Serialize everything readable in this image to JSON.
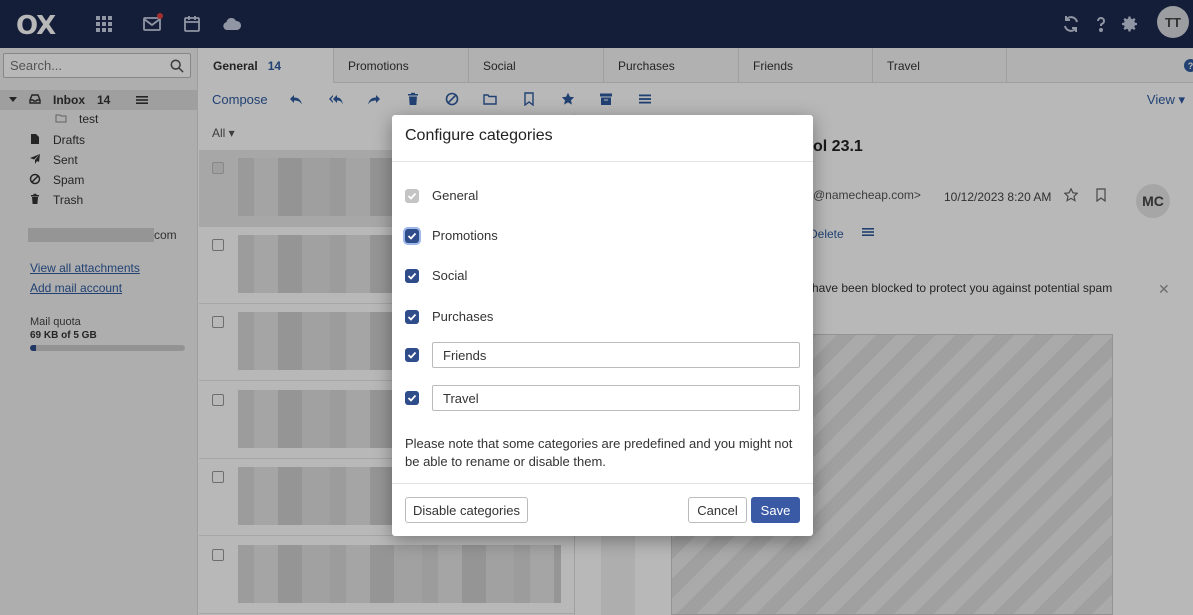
{
  "app": {
    "logo_text": "OX",
    "user_initials": "TT"
  },
  "sidebar": {
    "search_placeholder": "Search...",
    "inbox": {
      "label": "Inbox",
      "count": "14"
    },
    "folders": [
      {
        "label": "test",
        "icon": "folder-icon"
      },
      {
        "label": "Drafts",
        "icon": "file-icon"
      },
      {
        "label": "Sent",
        "icon": "send-icon"
      },
      {
        "label": "Spam",
        "icon": "ban-icon"
      },
      {
        "label": "Trash",
        "icon": "trash-icon"
      }
    ],
    "account_suffix": "com",
    "links": [
      "View all attachments",
      "Add mail account"
    ],
    "quota": {
      "label": "Mail quota",
      "value": "69 KB of 5 GB",
      "fill_percent": 4
    }
  },
  "tabs": [
    {
      "label": "General",
      "count": "14",
      "active": true
    },
    {
      "label": "Promotions"
    },
    {
      "label": "Social"
    },
    {
      "label": "Purchases"
    },
    {
      "label": "Friends"
    },
    {
      "label": "Travel"
    }
  ],
  "toolbar": {
    "compose": "Compose",
    "view": "View"
  },
  "list": {
    "filter": "All"
  },
  "message": {
    "subject_tail": "ol 23.1",
    "from_tail": "@namecheap.com>",
    "date": "10/12/2023 8:20 AM",
    "avatar": "MC",
    "delete_tail": "Delete",
    "warning_tail": "have been blocked to protect you against potential spam"
  },
  "modal": {
    "title": "Configure categories",
    "categories": [
      {
        "label": "General",
        "checked": true,
        "disabled": true,
        "editable": false
      },
      {
        "label": "Promotions",
        "checked": true,
        "editable": false
      },
      {
        "label": "Social",
        "checked": true,
        "editable": false
      },
      {
        "label": "Purchases",
        "checked": true,
        "editable": false
      },
      {
        "label": "Friends",
        "checked": true,
        "editable": true
      },
      {
        "label": "Travel",
        "checked": true,
        "editable": true
      }
    ],
    "note": "Please note that some categories are predefined and you might not be able to rename or disable them.",
    "disable_button": "Disable categories",
    "cancel_button": "Cancel",
    "save_button": "Save"
  },
  "colors": {
    "topbar": "#1c2a4f",
    "accent": "#2f5ba0",
    "primary_button": "#3b5aa6"
  }
}
